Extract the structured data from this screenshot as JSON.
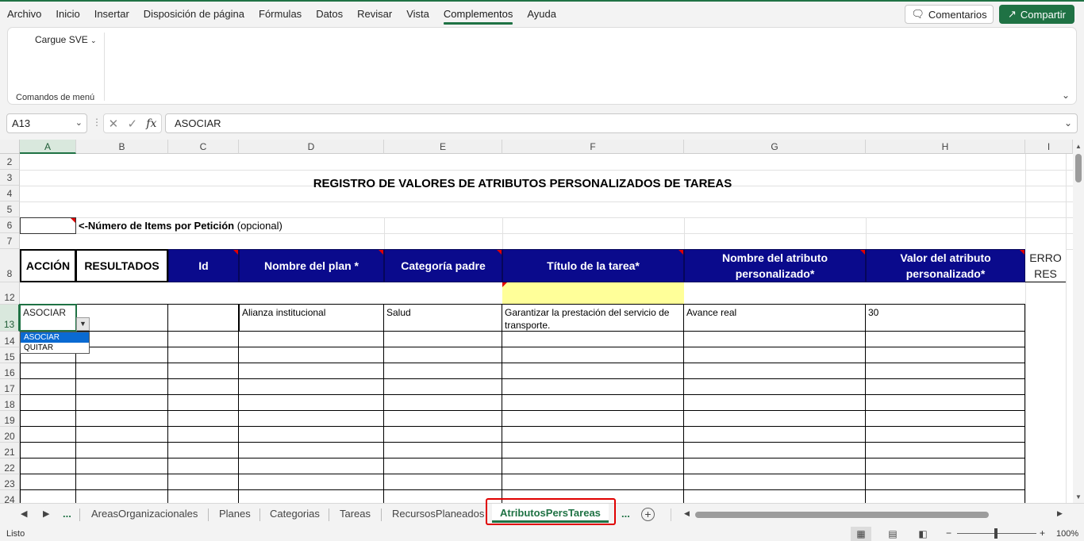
{
  "menu": {
    "items": [
      "Archivo",
      "Inicio",
      "Insertar",
      "Disposición de página",
      "Fórmulas",
      "Datos",
      "Revisar",
      "Vista",
      "Complementos",
      "Ayuda"
    ],
    "active": "Complementos",
    "comments_label": "Comentarios",
    "share_label": "Compartir"
  },
  "ribbon": {
    "command": "Cargue SVE",
    "group_label": "Comandos de menú"
  },
  "formula_bar": {
    "name_box": "A13",
    "formula": "ASOCIAR",
    "fx": "fx"
  },
  "columns": [
    "A",
    "B",
    "C",
    "D",
    "E",
    "F",
    "G",
    "H",
    "I"
  ],
  "selected_column": "A",
  "rows": [
    "2",
    "3",
    "4",
    "5",
    "6",
    "7",
    "8",
    "12",
    "13",
    "14",
    "15",
    "16",
    "17",
    "18",
    "19",
    "20",
    "21",
    "22",
    "23",
    "24"
  ],
  "selected_row": "13",
  "sheet": {
    "title": "REGISTRO DE VALORES DE ATRIBUTOS PERSONALIZADOS  DE TAREAS",
    "items_label_bold": "<-Número de Items por Petición",
    "items_label_rest": " (opcional)",
    "headers": {
      "accion": "ACCIÓN",
      "resultados": "RESULTADOS",
      "id": "Id",
      "nombre_plan": "Nombre del plan *",
      "categoria": "Categoría padre",
      "titulo": "Título de la tarea*",
      "nombre_atributo": "Nombre del atributo personalizado*",
      "valor_atributo": "Valor del atributo personalizado*",
      "errores": "ERRORES"
    },
    "row13": {
      "accion": "ASOCIAR",
      "nombre_plan": "Alianza institucional",
      "categoria": "Salud",
      "titulo": "Garantizar la prestación del servicio de transporte.",
      "nombre_atributo": "Avance real",
      "valor_atributo": "30"
    },
    "dropdown_options": [
      "ASOCIAR",
      "QUITAR"
    ]
  },
  "tabs": {
    "items": [
      "AreasOrganizacionales",
      "Planes",
      "Categorias",
      "Tareas",
      "RecursosPlaneados",
      "AtributosPersTareas"
    ],
    "active": "AtributosPersTareas",
    "more": "..."
  },
  "status": {
    "ready": "Listo",
    "zoom": "100%"
  },
  "colors": {
    "accent": "#1f7244",
    "header_blue": "#0a0a8c",
    "yellow": "#ffff99",
    "highlight_red": "#e00000"
  }
}
